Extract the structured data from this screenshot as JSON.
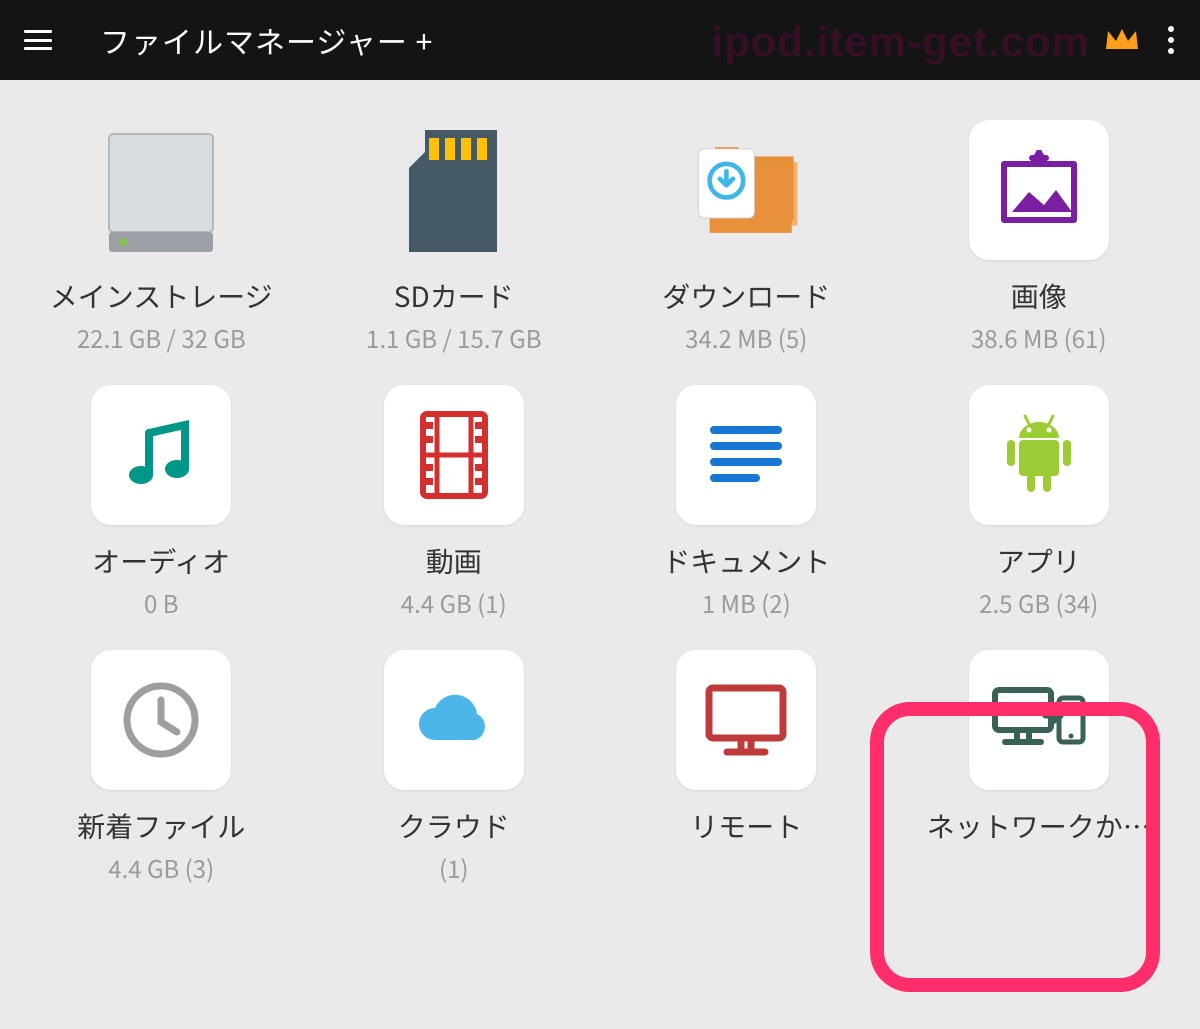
{
  "header": {
    "title": "ファイルマネージャー +",
    "watermark": "ipod.item-get.com"
  },
  "items": [
    {
      "id": "main-storage",
      "label": "メインストレージ",
      "sub": "22.1 GB / 32 GB"
    },
    {
      "id": "sd-card",
      "label": "SDカード",
      "sub": "1.1 GB / 15.7 GB"
    },
    {
      "id": "downloads",
      "label": "ダウンロード",
      "sub": "34.2 MB (5)"
    },
    {
      "id": "images",
      "label": "画像",
      "sub": "38.6 MB (61)"
    },
    {
      "id": "audio",
      "label": "オーディオ",
      "sub": "0 B"
    },
    {
      "id": "video",
      "label": "動画",
      "sub": "4.4 GB (1)"
    },
    {
      "id": "documents",
      "label": "ドキュメント",
      "sub": "1 MB (2)"
    },
    {
      "id": "apps",
      "label": "アプリ",
      "sub": "2.5 GB (34)"
    },
    {
      "id": "recent",
      "label": "新着ファイル",
      "sub": "4.4 GB (3)"
    },
    {
      "id": "cloud",
      "label": "クラウド",
      "sub": "(1)"
    },
    {
      "id": "remote",
      "label": "リモート",
      "sub": ""
    },
    {
      "id": "network",
      "label": "ネットワークか…",
      "sub": ""
    }
  ]
}
